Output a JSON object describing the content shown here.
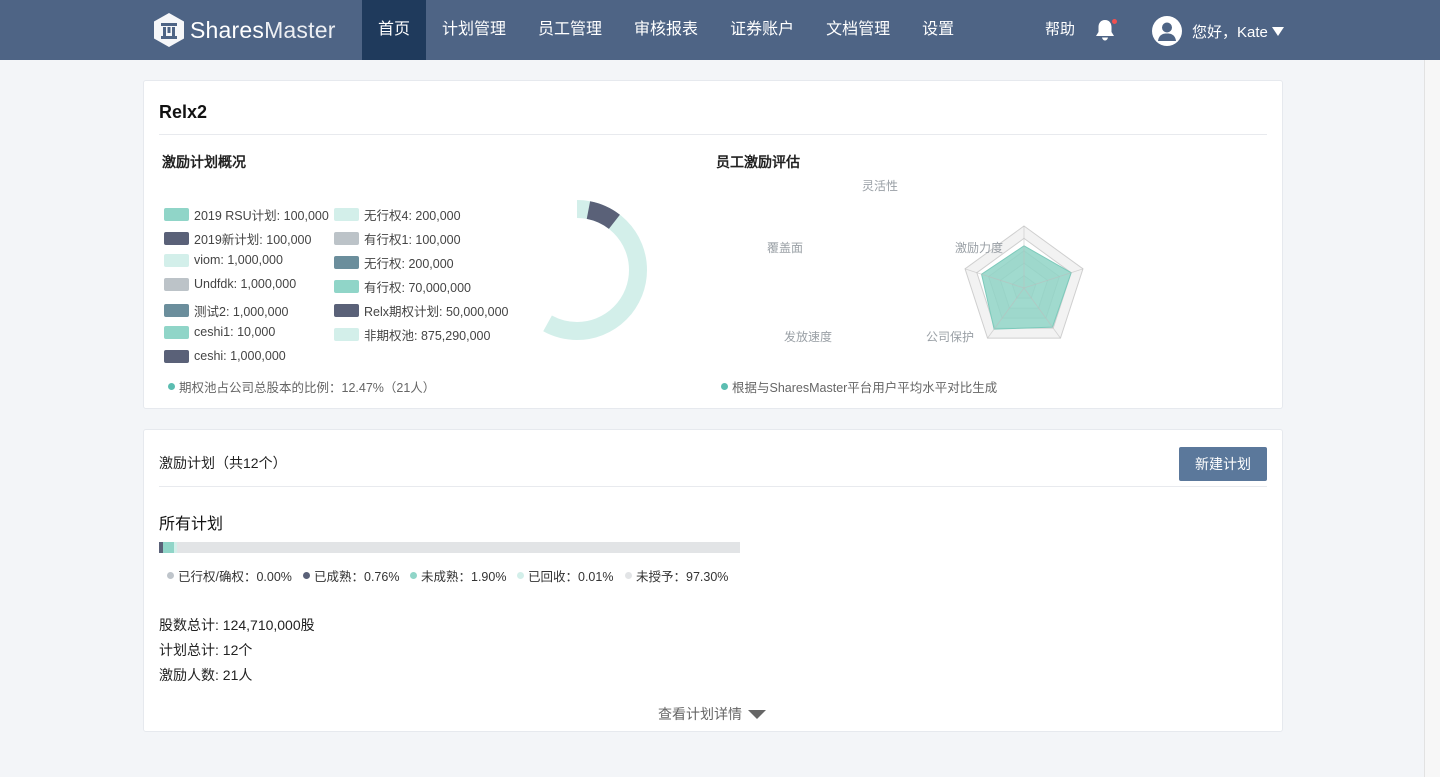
{
  "brand": {
    "name_part1": "Shares",
    "name_part2": "Master",
    "icon": "sharesmaster-logo-icon"
  },
  "nav": {
    "items": [
      {
        "label": "首页",
        "active": true
      },
      {
        "label": "计划管理"
      },
      {
        "label": "员工管理"
      },
      {
        "label": "审核报表"
      },
      {
        "label": "证券账户"
      },
      {
        "label": "文档管理"
      },
      {
        "label": "设置"
      }
    ],
    "help_label": "帮助",
    "bell_icon": "bell-icon",
    "greeting": "您好，Kate",
    "avatar_icon": "user-avatar-icon",
    "colors": {
      "bar": "#4e6485",
      "active": "#1f3a5c"
    }
  },
  "overview": {
    "company": "Relx2",
    "pool_title": "激励计划概况",
    "legend_col1": [
      {
        "label": "2019 RSU计划: 100,000",
        "color": "#90d5c8"
      },
      {
        "label": "2019新计划: 100,000",
        "color": "#5a6178"
      },
      {
        "label": "viom: 1,000,000",
        "color": "#d3efea"
      },
      {
        "label": "Undfdk: 1,000,000",
        "color": "#bcc3c8"
      },
      {
        "label": "测试2: 1,000,000",
        "color": "#6b8e9c"
      },
      {
        "label": "ceshi1: 10,000",
        "color": "#90d5c8"
      },
      {
        "label": "ceshi: 1,000,000",
        "color": "#5a6178"
      }
    ],
    "legend_col2": [
      {
        "label": "无行权4: 200,000",
        "color": "#d3efea"
      },
      {
        "label": "有行权1: 100,000",
        "color": "#bcc3c8"
      },
      {
        "label": "无行权: 200,000",
        "color": "#6b8e9c"
      },
      {
        "label": "有行权: 70,000,000",
        "color": "#90d5c8"
      },
      {
        "label": "Relx期权计划: 50,000,000",
        "color": "#5a6178"
      },
      {
        "label": "非期权池: 875,290,000",
        "color": "#d3efea"
      }
    ],
    "pool_note": "期权池占公司总股本的比例：12.47%（21人）",
    "pool_note_color": "#5bbdb1",
    "donut_ring_fraction": 0.58,
    "donut_highlight_fraction": 0.075,
    "eval_title": "员工激励评估",
    "radar_axes": [
      "灵活性",
      "激励力度",
      "公司保护",
      "发放速度",
      "覆盖面"
    ],
    "radar_values": [
      0.68,
      0.8,
      0.78,
      0.82,
      0.72
    ],
    "eval_note": "根据与SharesMaster平台用户平均水平对比生成",
    "eval_note_color": "#5bbdb1"
  },
  "plans": {
    "header": "激励计划（共12个）",
    "new_button": "新建计划",
    "all_title": "所有计划",
    "breakdown": [
      {
        "label": "已行权/确权：0.00%",
        "percent": 0.0,
        "color": "#bfc5cb"
      },
      {
        "label": "已成熟：0.76%",
        "percent": 0.76,
        "color": "#5a6178"
      },
      {
        "label": "未成熟：1.90%",
        "percent": 1.9,
        "color": "#90d5c8"
      },
      {
        "label": "已回收：0.01%",
        "percent": 0.01,
        "color": "#d3efea"
      },
      {
        "label": "未授予：97.30%",
        "percent": 97.3,
        "color": "#e2e4e6"
      }
    ],
    "stats": {
      "shares_total": "股数总计: 124,710,000股",
      "plan_total": "计划总计: 12个",
      "people": "激励人数: 21人"
    },
    "details_link": "查看计划详情"
  }
}
